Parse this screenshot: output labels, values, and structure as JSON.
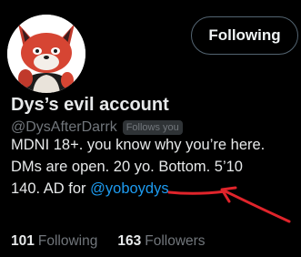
{
  "profile": {
    "display_name": "Dys’s evil account",
    "handle": "@DysAfterDarrk",
    "follows_you_badge": "Follows you",
    "avatar_icon": "fox-avatar-icon"
  },
  "actions": {
    "follow_button_label": "Following"
  },
  "bio": {
    "line1": "MDNI 18+. you know why you’re here.",
    "line2_before": "DMs are open. 20 yo. ",
    "line2_highlight": "Bottom",
    "line2_after": ". 5’10",
    "line3_before": "140. AD for ",
    "line3_link": "@yoboydys"
  },
  "stats": {
    "following_count": "101",
    "following_label": "Following",
    "followers_count": "163",
    "followers_label": "Followers"
  },
  "colors": {
    "background": "#000000",
    "text_primary": "#e7e9ea",
    "text_secondary": "#71767b",
    "link": "#1d9bf0",
    "annotation": "#e0242b"
  }
}
